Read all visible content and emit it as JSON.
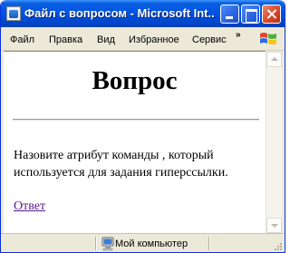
{
  "window": {
    "title": "Файл с вопросом - Microsoft Int..."
  },
  "menu": {
    "items": [
      "Файл",
      "Правка",
      "Вид",
      "Избранное",
      "Сервис"
    ],
    "overflow_symbol": "»"
  },
  "page": {
    "title": "Вопрос",
    "question": "Назовите атрибут команды , который используется для задания гиперссылки.",
    "answer_link": "Ответ"
  },
  "status": {
    "zone_text": "Мой компьютер"
  },
  "colors": {
    "titlebar": "#0054e3",
    "link_visited": "#551a8b",
    "chrome": "#ece9d8"
  },
  "icons": [
    "ie-page-icon",
    "minimize-icon",
    "maximize-icon",
    "close-icon",
    "chevron-overflow-icon",
    "windows-logo-icon",
    "my-computer-icon",
    "resize-grip-icon"
  ]
}
